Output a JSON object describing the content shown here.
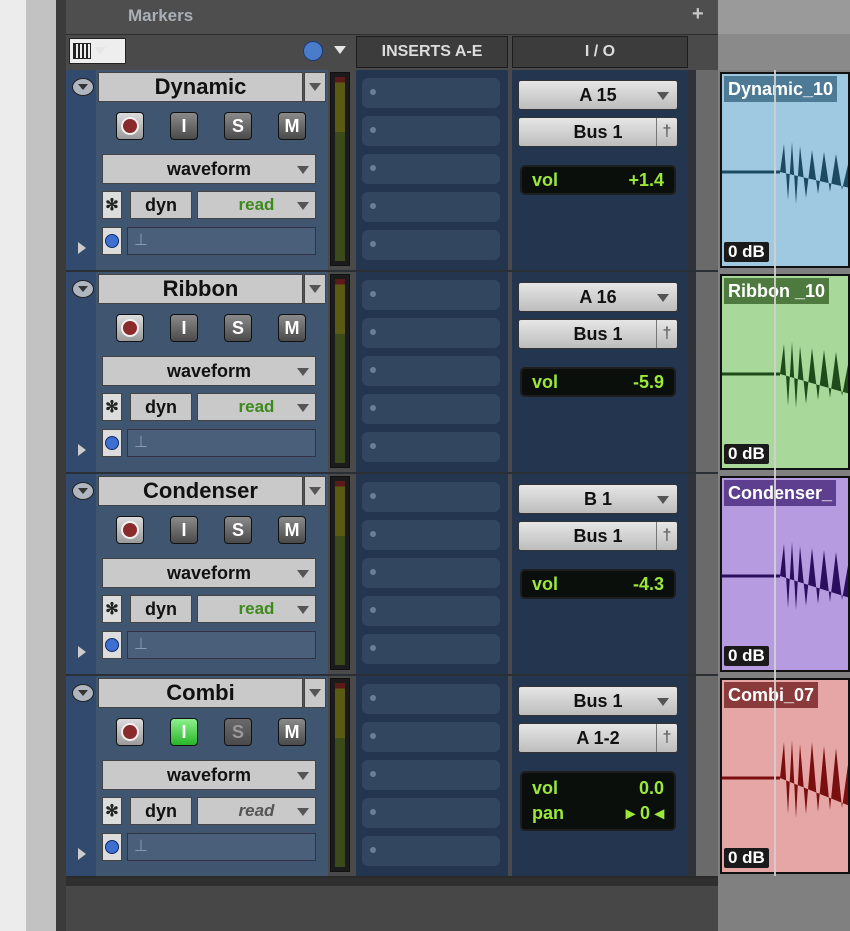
{
  "header": {
    "markers_label": "Markers",
    "plus_label": "+",
    "inserts_header": "INSERTS A-E",
    "io_header": "I / O"
  },
  "colors": {
    "track_body": "#40556f",
    "inserts_bg": "#24354f",
    "volume_text": "#9be83a",
    "read_text": "#3c8a1c"
  },
  "tracks": [
    {
      "name": "Dynamic",
      "rec": "",
      "input": "I",
      "solo": "S",
      "mute": "M",
      "input_state": "off",
      "view": "waveform",
      "automation_icon": "✻",
      "dyn": "dyn",
      "mode": "read",
      "comment_icon": "⊥",
      "io_input": "A 15",
      "io_output": "Bus 1",
      "vol_label": "vol",
      "vol_value": "+1.4",
      "clip_name": "Dynamic_10",
      "clip_color": "#9fc9e0",
      "clip_label_bg": "#4d7a94",
      "wave_color": "#1d4a63",
      "clip_gain": "0 dB"
    },
    {
      "name": "Ribbon",
      "rec": "",
      "input": "I",
      "solo": "S",
      "mute": "M",
      "input_state": "off",
      "view": "waveform",
      "automation_icon": "✻",
      "dyn": "dyn",
      "mode": "read",
      "comment_icon": "⊥",
      "io_input": "A 16",
      "io_output": "Bus 1",
      "vol_label": "vol",
      "vol_value": "-5.9",
      "clip_name": "Ribbon _10",
      "clip_color": "#a8d89a",
      "clip_label_bg": "#4e7a3f",
      "wave_color": "#1f4a1a",
      "clip_gain": "0 dB"
    },
    {
      "name": "Condenser",
      "rec": "",
      "input": "I",
      "solo": "S",
      "mute": "M",
      "input_state": "off",
      "view": "waveform",
      "automation_icon": "✻",
      "dyn": "dyn",
      "mode": "read",
      "comment_icon": "⊥",
      "io_input": "B 1",
      "io_output": "Bus 1",
      "vol_label": "vol",
      "vol_value": "-4.3",
      "clip_name": "Condenser_",
      "clip_color": "#b79be0",
      "clip_label_bg": "#5e3f8f",
      "wave_color": "#2a0f5e",
      "clip_gain": "0 dB"
    },
    {
      "name": "Combi",
      "rec": "",
      "input": "I",
      "solo": "S",
      "mute": "M",
      "input_state": "on",
      "view": "waveform",
      "automation_icon": "✻",
      "dyn": "dyn",
      "mode": "read",
      "comment_icon": "⊥",
      "io_input": "Bus 1",
      "io_output": "A 1-2",
      "vol_label": "vol",
      "vol_value": "0.0",
      "pan_label": "pan",
      "pan_value": "0",
      "clip_name": "Combi_07",
      "clip_color": "#e6a6a6",
      "clip_label_bg": "#8a3a3a",
      "wave_color": "#7a0f0f",
      "clip_gain": "0 dB"
    }
  ]
}
